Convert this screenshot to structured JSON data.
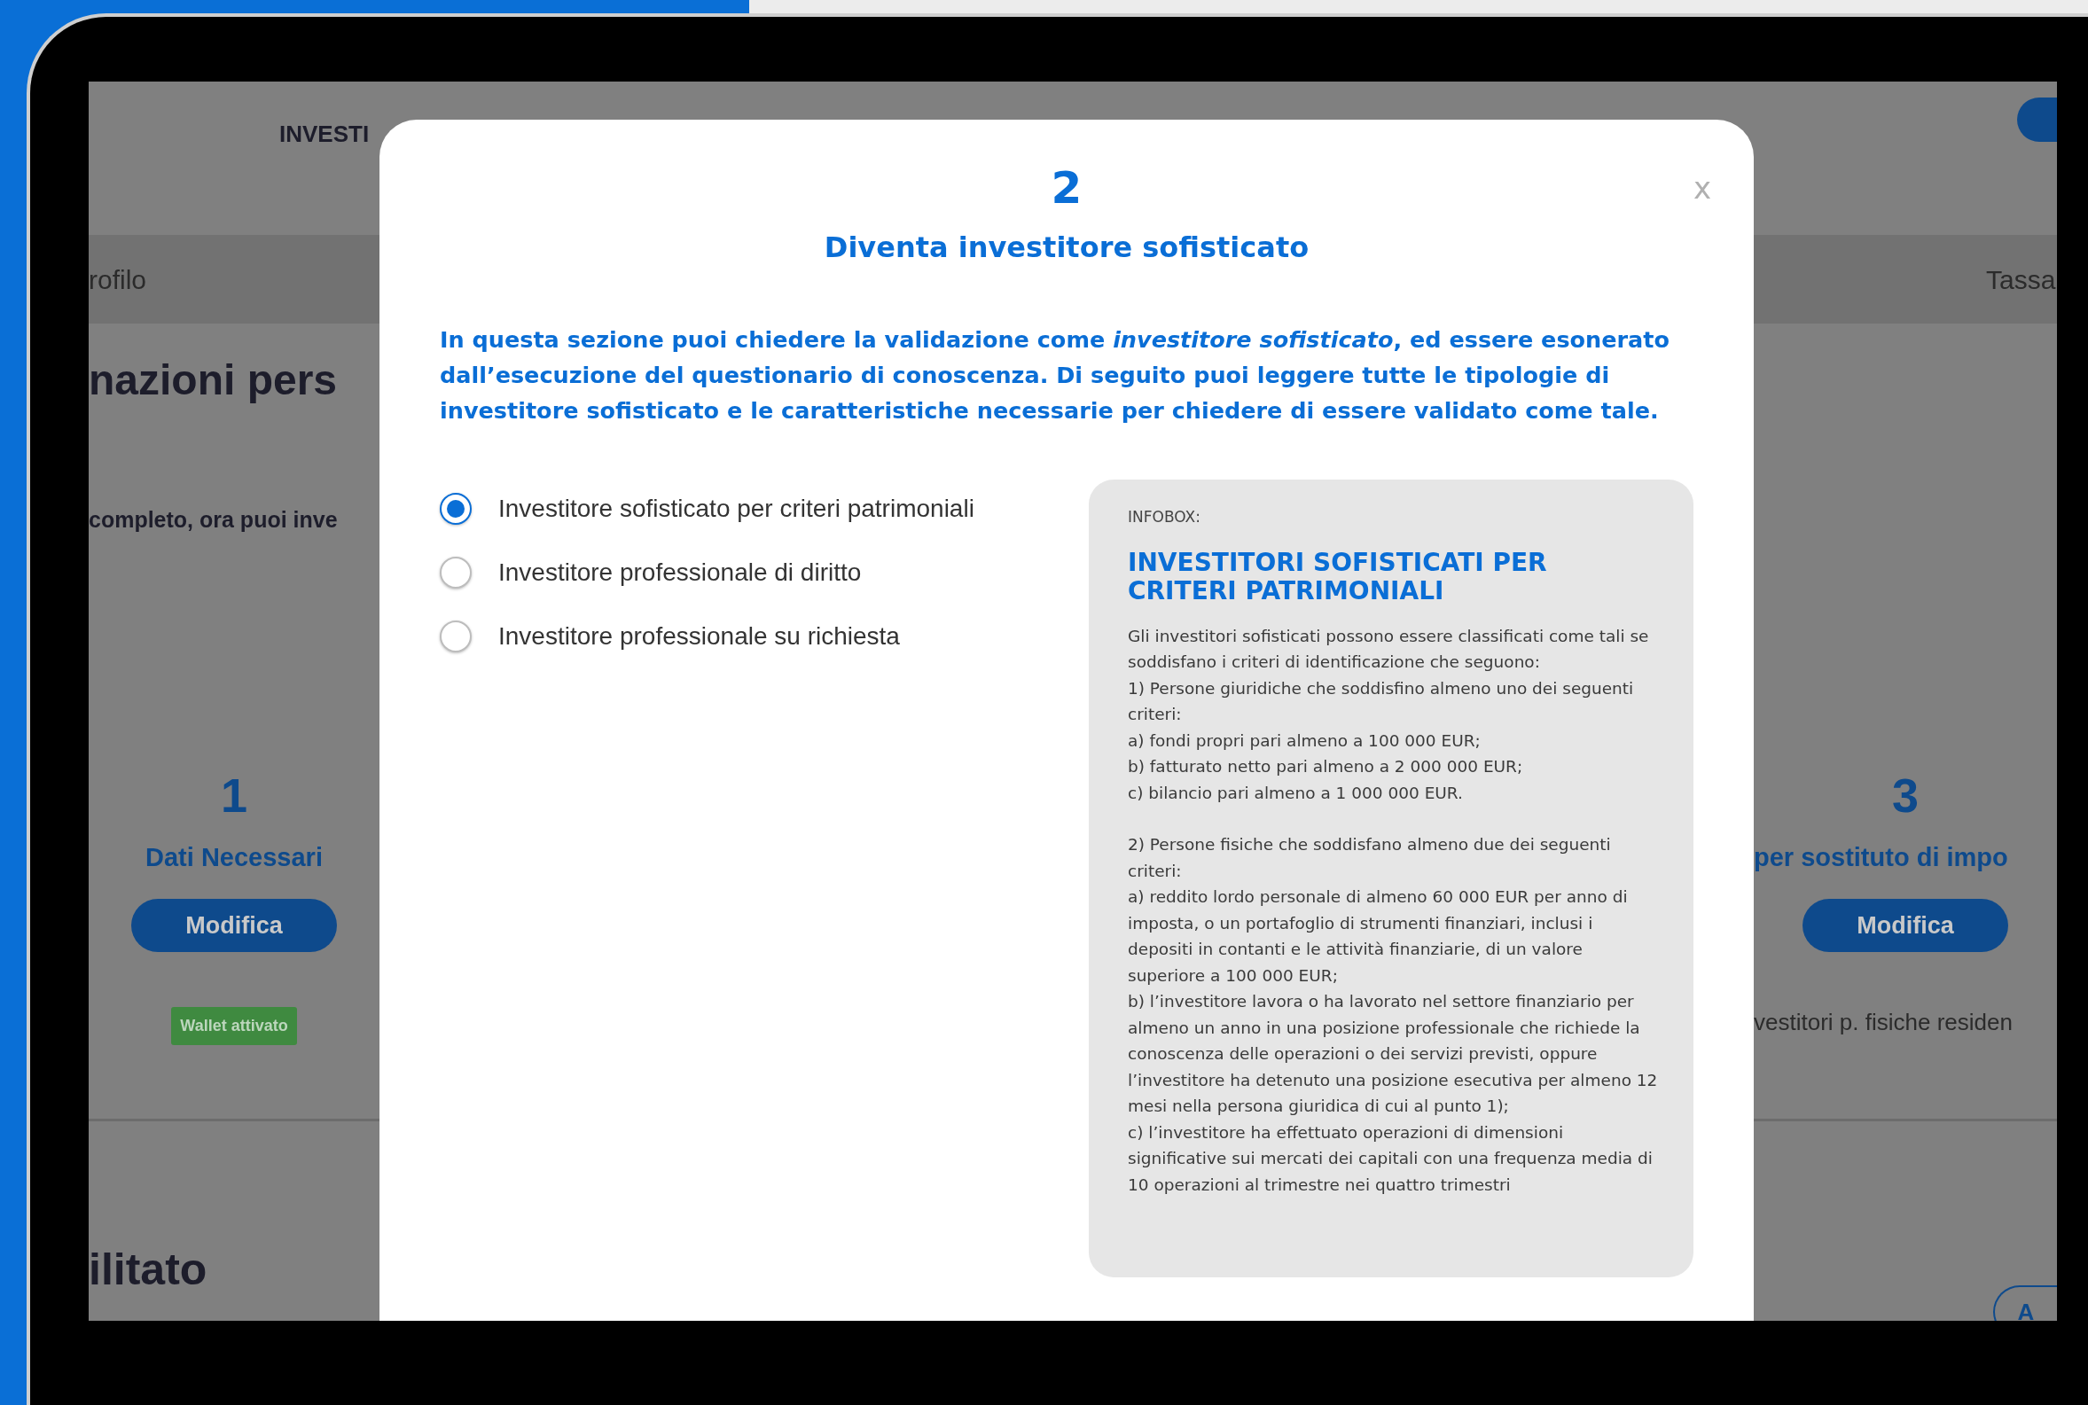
{
  "background_page": {
    "nav": [
      {
        "label": "INVESTI"
      }
    ],
    "tabs": [
      {
        "label": "rofilo"
      },
      {
        "label": "Tassa"
      }
    ],
    "heading": "nazioni pers",
    "subtitle": "completo, ora puoi inve",
    "steps": [
      {
        "number": "1",
        "title": "Dati Necessari",
        "button": "Modifica",
        "badge": "Wallet attivato"
      },
      {
        "number": "3",
        "title": "per sostituto di impo",
        "button": "Modifica",
        "note": "vestitori p. fisiche residen"
      }
    ],
    "section_heading": "ilitato",
    "section_button": "A"
  },
  "modal": {
    "close": "x",
    "step": "2",
    "title": "Diventa investitore sofisticato",
    "intro": "In questa sezione puoi chiedere la validazione come *investitore sofisticato*, ed essere esonerato dall’esecuzione del questionario di conoscenza. Di seguito puoi leggere tutte le tipologie di investitore sofisticato e le caratteristiche necessarie per chiedere di essere validato come tale.",
    "options": [
      {
        "label": "Investitore sofisticato per criteri patrimoniali",
        "selected": true
      },
      {
        "label": "Investitore professionale di diritto",
        "selected": false
      },
      {
        "label": "Investitore professionale su richiesta",
        "selected": false
      }
    ],
    "infobox": {
      "label": "INFOBOX:",
      "title": "INVESTITORI SOFISTICATI PER CRITERI PATRIMONIALI",
      "paragraphs": [
        [
          "Gli investitori sofisticati possono essere classificati come tali se soddisfano i criteri di identificazione che seguono:",
          "1) Persone giuridiche che soddisfino almeno uno dei seguenti criteri:",
          "a) fondi propri pari almeno a 100 000 EUR;",
          "b) fatturato netto pari almeno a 2 000 000 EUR;",
          "c) bilancio pari almeno a 1 000 000 EUR."
        ],
        [
          "2) Persone fisiche che soddisfano almeno due dei seguenti criteri:",
          "a) reddito lordo personale di almeno 60 000 EUR per anno di imposta, o un portafoglio di strumenti finanziari, inclusi i depositi in contanti e le attività finanziarie, di un valore superiore a 100 000 EUR;",
          "b) l’investitore lavora o ha lavorato nel settore finanziario per almeno un anno in una posizione professionale che richiede la conoscenza delle operazioni o dei servizi previsti, oppure l’investitore ha detenuto una posizione esecutiva per almeno 12 mesi nella persona giuridica di cui al punto 1);",
          "c) l’investitore ha effettuato operazioni di dimensioni significative sui mercati dei capitali con una frequenza media di 10 operazioni al trimestre nei quattro trimestri"
        ]
      ]
    }
  }
}
